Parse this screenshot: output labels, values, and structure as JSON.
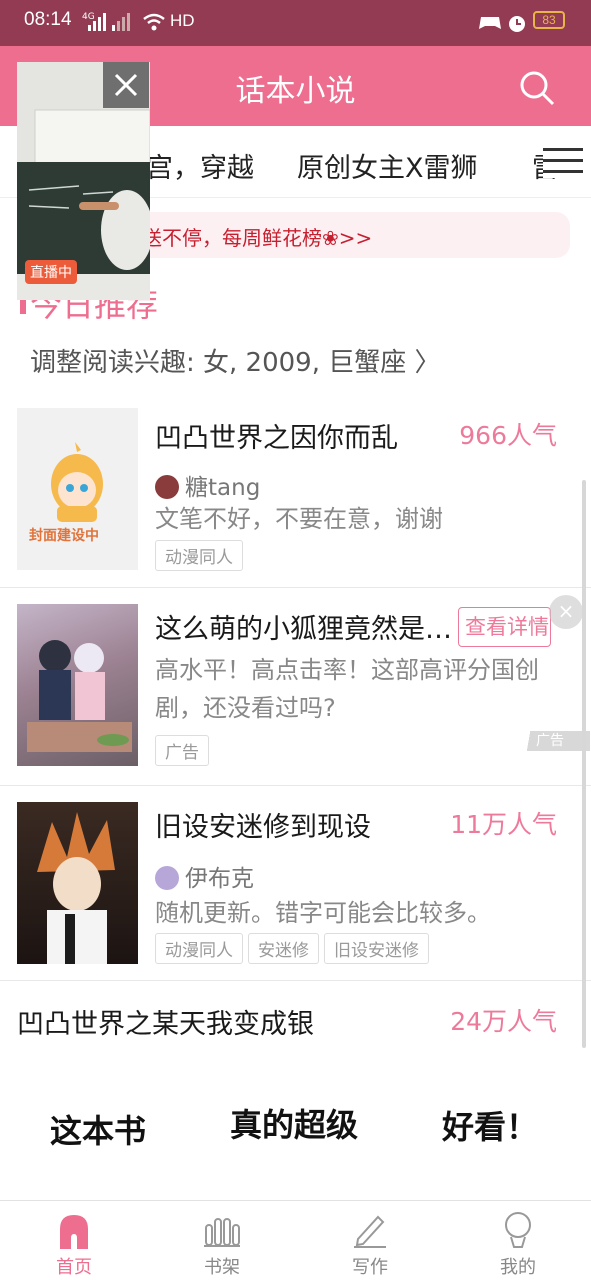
{
  "status_bar": {
    "time": "08:14",
    "network_label": "4G",
    "hd_label": "HD",
    "battery": "83"
  },
  "header": {
    "title": "话本小说"
  },
  "categories": [
    "宫，穿越",
    "原创女主X雷狮",
    "雷"
  ],
  "notice": {
    "text": "送不停，每周鲜花榜❀>>"
  },
  "live_video": {
    "badge": "直播中"
  },
  "section": {
    "title": "今日推荐",
    "interest_text": "调整阅读兴趣: 女, 2009, 巨蟹座 〉"
  },
  "books": [
    {
      "title": "凹凸世界之因你而乱",
      "popularity": "966人气",
      "author": "糖tang",
      "description": "文笔不好，不要在意，谢谢",
      "tags": [
        "动漫同人"
      ],
      "cover_text": "封面建设中"
    },
    {
      "title": "这么萌的小狐狸竟然是…",
      "detail_button": "查看详情",
      "description": "高水平！高点击率！这部高评分国创剧，还没看过吗?",
      "tags": [
        "广告"
      ],
      "ad_mark": "广告"
    },
    {
      "title": "旧设安迷修到现设",
      "popularity": "11万人气",
      "author": "伊布克",
      "description": "随机更新。错字可能会比较多。",
      "tags": [
        "动漫同人",
        "安迷修",
        "旧设安迷修"
      ]
    },
    {
      "title": "凹凸世界之某天我变成银",
      "popularity": "24万人气"
    }
  ],
  "promo": {
    "part1": "这本书",
    "part2": "真的超级",
    "part3": "好看！"
  },
  "bottom_nav": [
    {
      "label": "首页",
      "icon": "home-icon",
      "active": true
    },
    {
      "label": "书架",
      "icon": "bookshelf-icon",
      "active": false
    },
    {
      "label": "写作",
      "icon": "pen-icon",
      "active": false
    },
    {
      "label": "我的",
      "icon": "profile-icon",
      "active": false
    }
  ],
  "colors": {
    "status_bar": "#923b52",
    "accent": "#ed6e8f",
    "notice_text": "#c61f2f",
    "popularity": "#ee7a9b"
  }
}
